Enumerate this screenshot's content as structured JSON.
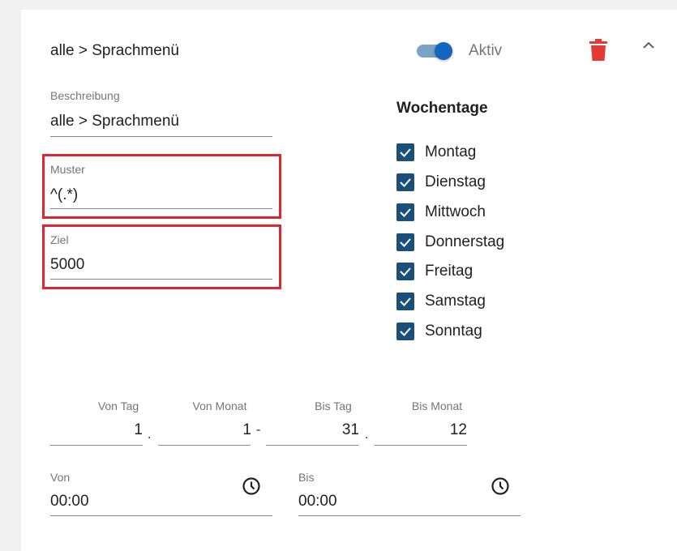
{
  "header": {
    "title": "alle > Sprachmenü",
    "toggle_label": "Aktiv",
    "toggle_on": true
  },
  "fields": {
    "beschreibung": {
      "label": "Beschreibung",
      "value": "alle > Sprachmenü"
    },
    "muster": {
      "label": "Muster",
      "value": "^(.*)"
    },
    "ziel": {
      "label": "Ziel",
      "value": "5000"
    }
  },
  "wochentage": {
    "title": "Wochentage",
    "days": [
      {
        "label": "Montag",
        "checked": true
      },
      {
        "label": "Dienstag",
        "checked": true
      },
      {
        "label": "Mittwoch",
        "checked": true
      },
      {
        "label": "Donnerstag",
        "checked": true
      },
      {
        "label": "Freitag",
        "checked": true
      },
      {
        "label": "Samstag",
        "checked": true
      },
      {
        "label": "Sonntag",
        "checked": true
      }
    ]
  },
  "dates": {
    "von_tag": {
      "label": "Von Tag",
      "value": "1",
      "sep": "."
    },
    "von_monat": {
      "label": "Von Monat",
      "value": "1",
      "sep": "-"
    },
    "bis_tag": {
      "label": "Bis Tag",
      "value": "31",
      "sep": "."
    },
    "bis_monat": {
      "label": "Bis Monat",
      "value": "12"
    }
  },
  "times": {
    "von": {
      "label": "Von",
      "value": "00:00"
    },
    "bis": {
      "label": "Bis",
      "value": "00:00"
    }
  },
  "colors": {
    "accent": "#1565c0",
    "checkbox": "#1a4f7a",
    "delete": "#e53935",
    "highlight": "#e0252f"
  },
  "icons": {
    "delete": "trash-icon",
    "collapse": "chevron-up-icon",
    "time": "clock-icon",
    "check": "check-icon"
  }
}
